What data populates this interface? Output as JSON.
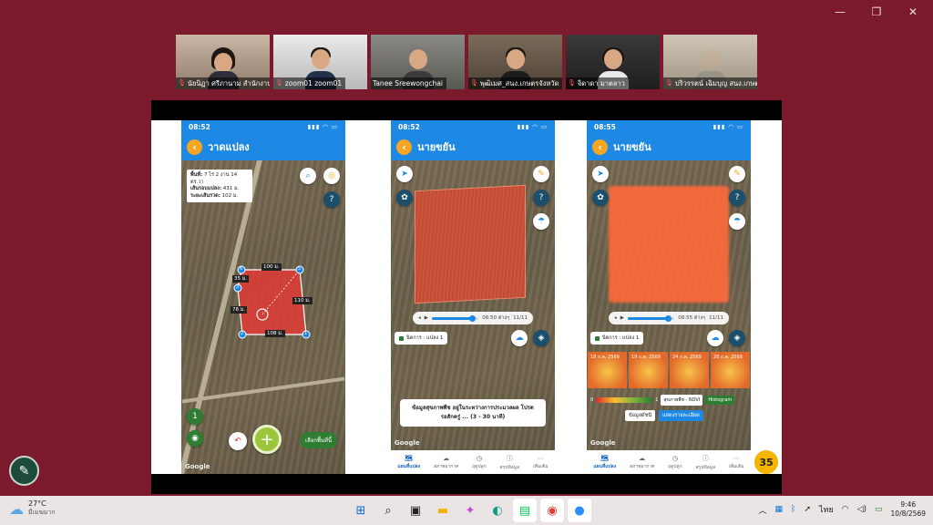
{
  "participants": [
    {
      "name": "นัยนิฏา ศรีภานาม สำนักงานเกษตร",
      "active": false,
      "muted": true
    },
    {
      "name": "zoom01 zoom01",
      "active": false,
      "muted": true
    },
    {
      "name": "Tanee Sreewongchai",
      "active": true,
      "muted": false
    },
    {
      "name": "พุฒิเมศ_สนง.เกษตรจังหวัด",
      "active": false,
      "muted": true
    },
    {
      "name": "จิดาดา มาตลาว",
      "active": false,
      "muted": true
    },
    {
      "name": "ปริวรรตน์ เฉิมบุญ สนง.เกษตร",
      "active": false,
      "muted": true
    }
  ],
  "phone1": {
    "time": "08:52",
    "title": "วาดแปลง",
    "info": {
      "area_label": "พื้นที่:",
      "area_value": "7 ไร่ 2 งาน 14 ตร.วา",
      "perimeter_label": "เส้นรอบแปลง:",
      "perimeter_value": "431 ม.",
      "width_label": "ระยะเส้นรวด:",
      "width_value": "102 ม."
    },
    "edges": [
      "100 ม.",
      "110 ม.",
      "108 ม.",
      "78 ม.",
      "35 ม."
    ],
    "vertices": [
      "6",
      "5",
      "1",
      "2",
      "3"
    ],
    "add_more": "เลือกพื้นที่นี้",
    "google": "Google"
  },
  "phone2": {
    "time": "08:52",
    "title": "นายขยัน",
    "player_time": "08:50 ต่างๆ",
    "player_date": "11/11",
    "plot_chip": "นิตการ : แปลง 1",
    "loading_msg_1": "ข้อมูลสุขภาพพืช อยู่ในระหว่างการประมวลผล โปรด",
    "loading_msg_2": "รอสักครู่ ... (3 - 30 นาที)",
    "google": "Google"
  },
  "phone3": {
    "time": "08:55",
    "title": "นายขยัน",
    "player_time": "08:55 ต่างๆ",
    "player_date": "11/11",
    "plot_chip": "นิตการ : แปลง 1",
    "thumbs": [
      "18 ก.ค. 2569",
      "19 ก.ค. 2569",
      "24 ก.ค. 2569",
      "28 ก.ค. 2569"
    ],
    "legend_min": "0",
    "legend_max": "1",
    "index_btn": "สุขภาพพืช - NDVI",
    "histogram_btn": "Histogram",
    "info_btn": "ข้อมูลดัชนี",
    "detail_btn": "แสดงรายละเอียด",
    "google": "Google"
  },
  "tabs": [
    {
      "label": "แผนที่แปลง",
      "icon": "🗺"
    },
    {
      "label": "สภาพอากาศ",
      "icon": "☁"
    },
    {
      "label": "ฤดูปลูก",
      "icon": "◷"
    },
    {
      "label": "สรุปข้อมูล",
      "icon": "ⓘ"
    },
    {
      "label": "เพิ่มเติม",
      "icon": "⋯"
    }
  ],
  "badge_number": "35",
  "taskbar": {
    "temp": "27°C",
    "weather": "มีเมฆมาก",
    "lang": "ไทย",
    "time": "9:46",
    "date": "10/8/2569"
  },
  "colors": {
    "app_blue": "#1e88e5",
    "ndvi_orange": "#ff6a3a",
    "active_border": "#3ccb5a"
  }
}
